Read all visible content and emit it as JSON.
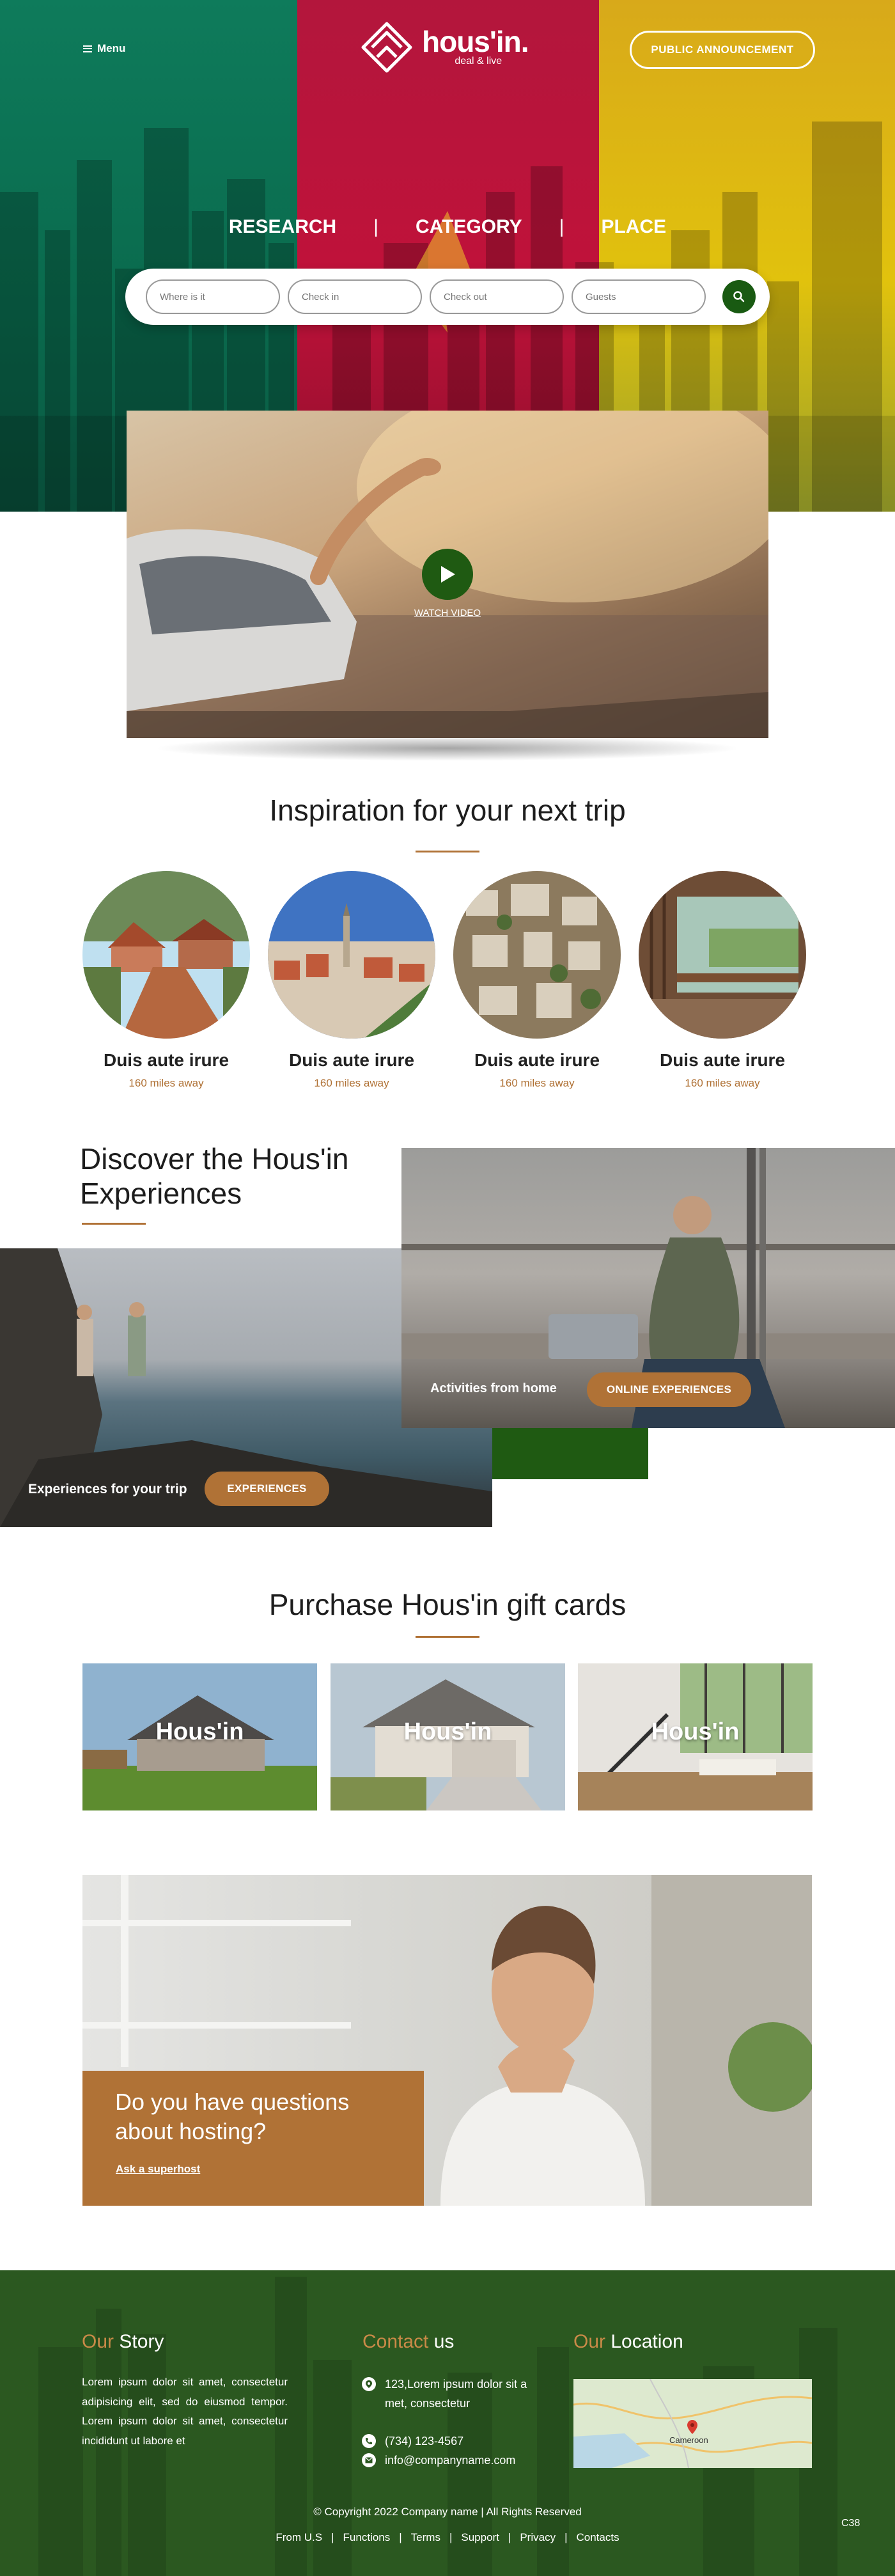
{
  "header": {
    "menu_label": "Menu",
    "logo_main": "hous'in.",
    "logo_sub": "deal & live",
    "announcement_label": "PUBLIC ANNOUNCEMENT"
  },
  "tabs": [
    {
      "label": "RESEARCH"
    },
    {
      "label": "CATEGORY"
    },
    {
      "label": "PLACE"
    }
  ],
  "tab_separator": "|",
  "search": {
    "where_placeholder": "Where is it",
    "checkin_placeholder": "Check in",
    "checkout_placeholder": "Check out",
    "guests_placeholder": "Guests"
  },
  "video": {
    "watch_label": "WATCH VIDEO"
  },
  "inspiration": {
    "title": "Inspiration for your next trip",
    "items": [
      {
        "name": "Duis aute irure",
        "distance": "160 miles away"
      },
      {
        "name": "Duis aute irure",
        "distance": "160 miles away"
      },
      {
        "name": "Duis aute irure",
        "distance": "160 miles away"
      },
      {
        "name": "Duis aute irure",
        "distance": "160 miles away"
      }
    ]
  },
  "discover": {
    "title_line1": "Discover the Hous'in",
    "title_line2": "Experiences",
    "left_label": "Experiences for your trip",
    "left_button": "EXPERIENCES",
    "right_label": "Activities from home",
    "right_button": "ONLINE EXPERIENCES"
  },
  "gifts": {
    "title": "Purchase Hous'in gift cards",
    "cards": [
      {
        "label": "Hous'in"
      },
      {
        "label": "Hous'in"
      },
      {
        "label": "Hous'in"
      }
    ]
  },
  "hosting": {
    "question_line1": "Do you have questions",
    "question_line2": "about hosting?",
    "link": "Ask a superhost"
  },
  "footer": {
    "story_accent": "Our",
    "story_rest": " Story",
    "story_text": "Lorem ipsum dolor sit amet, consectetur adipisicing elit, sed do eiusmod tempor. Lorem ipsum dolor sit amet, consectetur incididunt ut labore et",
    "contact_accent": "Contact",
    "contact_rest": " us",
    "address_line1": "123,Lorem ipsum dolor sit a",
    "address_line2": "met, consectetur",
    "phone": "(734) 123-4567",
    "email": "info@companyname.com",
    "location_accent": "Our",
    "location_rest": " Location",
    "map_label": "Cameroon",
    "copyright": "© Copyright 2022 Company name | All Rights Reserved",
    "links": [
      "From U.S",
      "Functions",
      "Terms",
      "Support",
      "Privacy",
      "Contacts"
    ],
    "link_separator": "|",
    "code": "C38"
  },
  "colors": {
    "green": "#1f5a12",
    "red": "#c0123a",
    "yellow": "#e1c20d",
    "accent_brown": "#b07236",
    "footer_green": "#2b5820"
  },
  "icons": {
    "menu": "hamburger-icon",
    "search": "search-icon",
    "play": "play-icon",
    "location": "map-pin-icon",
    "phone": "phone-icon",
    "email": "email-icon"
  }
}
